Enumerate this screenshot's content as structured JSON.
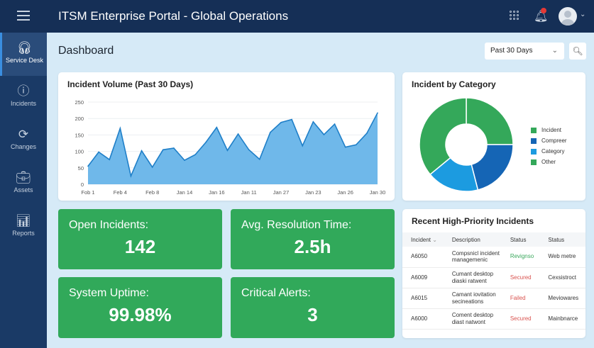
{
  "header": {
    "title": "ITSM Enterprise Portal - Global Operations"
  },
  "sidebar": {
    "items": [
      {
        "label": "Service Desk",
        "icon": "headset-icon",
        "active": true
      },
      {
        "label": "Incidents",
        "icon": "alert-circle-icon"
      },
      {
        "label": "Changes",
        "icon": "refresh-icon"
      },
      {
        "label": "Assets",
        "icon": "briefcase-icon"
      },
      {
        "label": "Reports",
        "icon": "report-icon"
      }
    ]
  },
  "main": {
    "title": "Dashboard",
    "range_select": "Past 30 Days"
  },
  "kpis": [
    {
      "label": "Open Incidents:",
      "value": "142"
    },
    {
      "label": "Avg. Resolution Time:",
      "value": "2.5h"
    },
    {
      "label": "System Uptime:",
      "value": "99.98%"
    },
    {
      "label": "Critical Alerts:",
      "value": "3"
    }
  ],
  "table": {
    "title": "Recent High-Priority Incidents",
    "headers": [
      "Incident",
      "Description",
      "Status",
      "Status"
    ],
    "rows": [
      [
        "A6050",
        "Compsnicl incident managemenic",
        "Revignso",
        "Web metre"
      ],
      [
        "A6009",
        "Cumant desktop diaski ratwent",
        "Secured",
        "Cexsistroct"
      ],
      [
        "A6015",
        "Camant iovitation secineations",
        "Failed",
        "Meviowares"
      ],
      [
        "A6000",
        "Coment desktop diast natwont",
        "Secured",
        "Mainbnarce"
      ]
    ],
    "status_colors": {
      "Revignso": "#3aa85c",
      "Secured": "#d9534f",
      "Failed": "#d9534f"
    }
  },
  "chart_data": [
    {
      "type": "area",
      "title": "Incident Volume (Past 30 Days)",
      "ylim": [
        0,
        250
      ],
      "yticks": [
        0,
        50,
        100,
        150,
        200,
        250
      ],
      "grid": true,
      "xtick_labels": [
        "Fob 1",
        "Feb 4",
        "Feb 8",
        "Jan 14",
        "Jan 16",
        "Jan 11",
        "Jan 27",
        "Jan 23",
        "Jan 26",
        "Jan 30"
      ],
      "values": [
        55,
        98,
        75,
        170,
        25,
        102,
        52,
        105,
        110,
        73,
        90,
        128,
        173,
        103,
        153,
        105,
        76,
        158,
        188,
        197,
        117,
        190,
        151,
        183,
        113,
        120,
        155,
        217
      ],
      "color": "#2f8fd6"
    },
    {
      "type": "pie",
      "title": "Incident by Category",
      "donut": true,
      "categories": [
        "Incident",
        "Compreer",
        "Category",
        "Other"
      ],
      "values": [
        25,
        21,
        18,
        36
      ],
      "colors": [
        "#34a85a",
        "#1565b5",
        "#1c9be0",
        "#34a85a"
      ],
      "legend": "right"
    }
  ]
}
